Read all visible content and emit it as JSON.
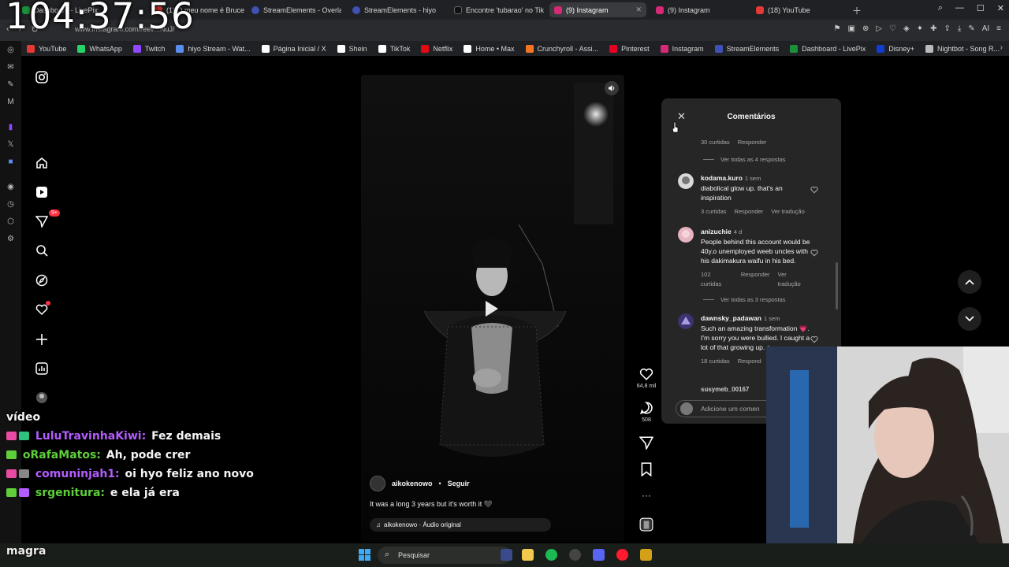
{
  "overlay": {
    "clock": "104:37:56"
  },
  "browser": {
    "tabs": [
      {
        "title": "Dashboard - LivePix",
        "color": "#1b8f3a"
      },
      {
        "title": "(1) O meu nome é Bruce",
        "color": "#e53935"
      },
      {
        "title": "StreamElements - Overlay",
        "color": "#3f51b5"
      },
      {
        "title": "StreamElements - hiyo",
        "color": "#3f51b5"
      },
      {
        "title": "Encontre 'tubarao' no TikTok",
        "color": "#111111"
      },
      {
        "title": "(9) Instagram",
        "color": "#d62976",
        "active": true
      },
      {
        "title": "(9) Instagram",
        "color": "#d62976"
      },
      {
        "title": "(18) YouTube",
        "color": "#e53935"
      }
    ],
    "url": "www.instagram.com/reel/...NuJ/",
    "bookmarks": [
      {
        "label": "YouTube",
        "color": "#e53935"
      },
      {
        "label": "WhatsApp",
        "color": "#25d366"
      },
      {
        "label": "Twitch",
        "color": "#9146ff"
      },
      {
        "label": "hiyo Stream - Wat...",
        "color": "#5b8def"
      },
      {
        "label": "Página Inicial / X",
        "color": "#ffffff"
      },
      {
        "label": "Shein",
        "color": "#ffffff"
      },
      {
        "label": "TikTok",
        "color": "#ffffff"
      },
      {
        "label": "Netflix",
        "color": "#e50914"
      },
      {
        "label": "Home • Max",
        "color": "#ffffff"
      },
      {
        "label": "Crunchyroll - Assi...",
        "color": "#f47521"
      },
      {
        "label": "Pinterest",
        "color": "#e60023"
      },
      {
        "label": "Instagram",
        "color": "#d62976"
      },
      {
        "label": "StreamElements",
        "color": "#3f51b5"
      },
      {
        "label": "Dashboard - LivePix",
        "color": "#1b8f3a"
      },
      {
        "label": "Disney+",
        "color": "#113ccf"
      },
      {
        "label": "Nightbot - Song R...",
        "color": "#bbbbbb"
      }
    ]
  },
  "instagram": {
    "nav_badge": "9+",
    "reel": {
      "author": "aikokenowo",
      "separator": "•",
      "follow": "Seguir",
      "caption": "It was a long 3 years but it's worth it 🖤",
      "audio": "aikokenowo · Áudio original",
      "likes": "64,8 mil",
      "comments": "508"
    },
    "comments_panel": {
      "title": "Comentários",
      "top_meta": {
        "likes": "30 curtidas",
        "reply": "Responder"
      },
      "view_replies_1": "Ver todas as 4 respostas",
      "items": [
        {
          "user": "kodama.kuro",
          "time": "1 sem",
          "text": "diabolical glow up. that's an inspiration",
          "likes": "3 curtidas",
          "reply": "Responder",
          "translate": "Ver tradução"
        },
        {
          "user": "anizuchie",
          "time": "4 d",
          "text": "People behind this account would be 40y.o unemployed weeb uncles with his dakimakura waifu in his bed.",
          "likes": "102 curtidas",
          "reply": "Responder",
          "translate": "Ver tradução"
        },
        {
          "user": "dawnsky_padawan",
          "time": "1 sem",
          "text": "Such an amazing transformation 💗. I'm sorry you were bullied. I caught a lot of that growing up. a",
          "likes": "18 curtidas",
          "reply": "Respond"
        }
      ],
      "view_replies_2": "Ver todas as 3 respostas",
      "next_user": "susymeb_00167",
      "input_placeholder": "Adicione um comen"
    }
  },
  "chat": [
    {
      "name": "",
      "text": "vídeo",
      "color": "#ffffff"
    },
    {
      "name": "LuluTravinhaKiwi:",
      "text": "Fez demais",
      "color": "#b45cff"
    },
    {
      "name": "oRafaMatos:",
      "text": "Ah, pode crer",
      "color": "#5ecf3a"
    },
    {
      "name": "comuninjah1:",
      "text": "oi hyo feliz ano novo",
      "color": "#b45cff"
    },
    {
      "name": "srgenitura:",
      "text": "e ela já era",
      "color": "#5ecf3a"
    }
  ],
  "chat_tail": "magra",
  "taskbar": {
    "search": "Pesquisar"
  }
}
